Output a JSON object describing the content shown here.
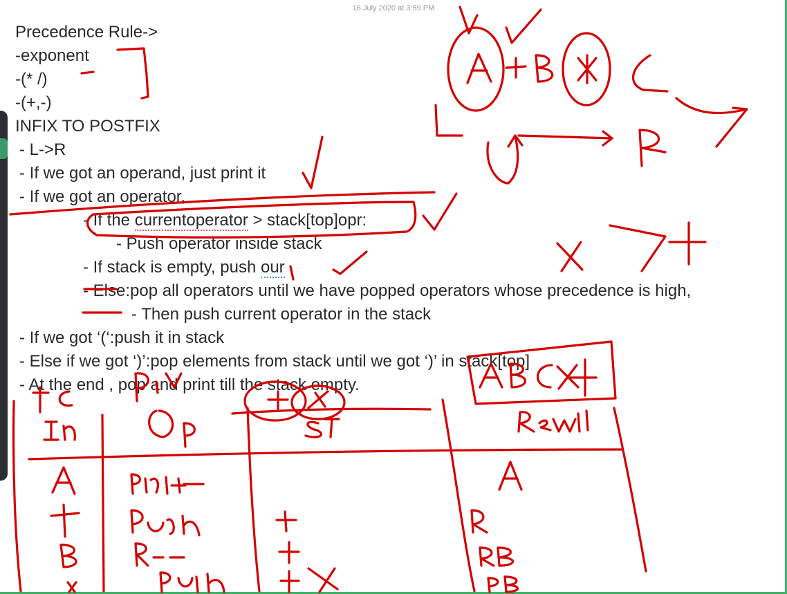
{
  "timestamp": "16 July 2020 at 3:59 PM",
  "note": {
    "lines": [
      "Precedence Rule->",
      "-exponent",
      "-(* /)",
      "-(+,-)",
      "INFIX TO POSTFIX",
      "- L->R",
      "- If we got an operand, just print it",
      "- If we got an operator,",
      "- If the ",
      "currentoperator",
      " > stack[top]opr:",
      "- Push operator inside stack",
      "- If stack is empty, push ",
      "our",
      "- Else:pop all operators until we have popped operators whose precedence is high,",
      "- Then push current operator in the stack",
      "- If we got ‘(‘:push it in stack",
      "- Else if we got ‘)’:pop elements from stack until we got ‘)’ in stack[top]",
      "- At the end , pop and print till the stack empty."
    ]
  },
  "colors": {
    "ink": "#d40000",
    "text": "#2a2a2a",
    "timestamp": "#9a9a9a",
    "accent_green": "#43b36a"
  }
}
